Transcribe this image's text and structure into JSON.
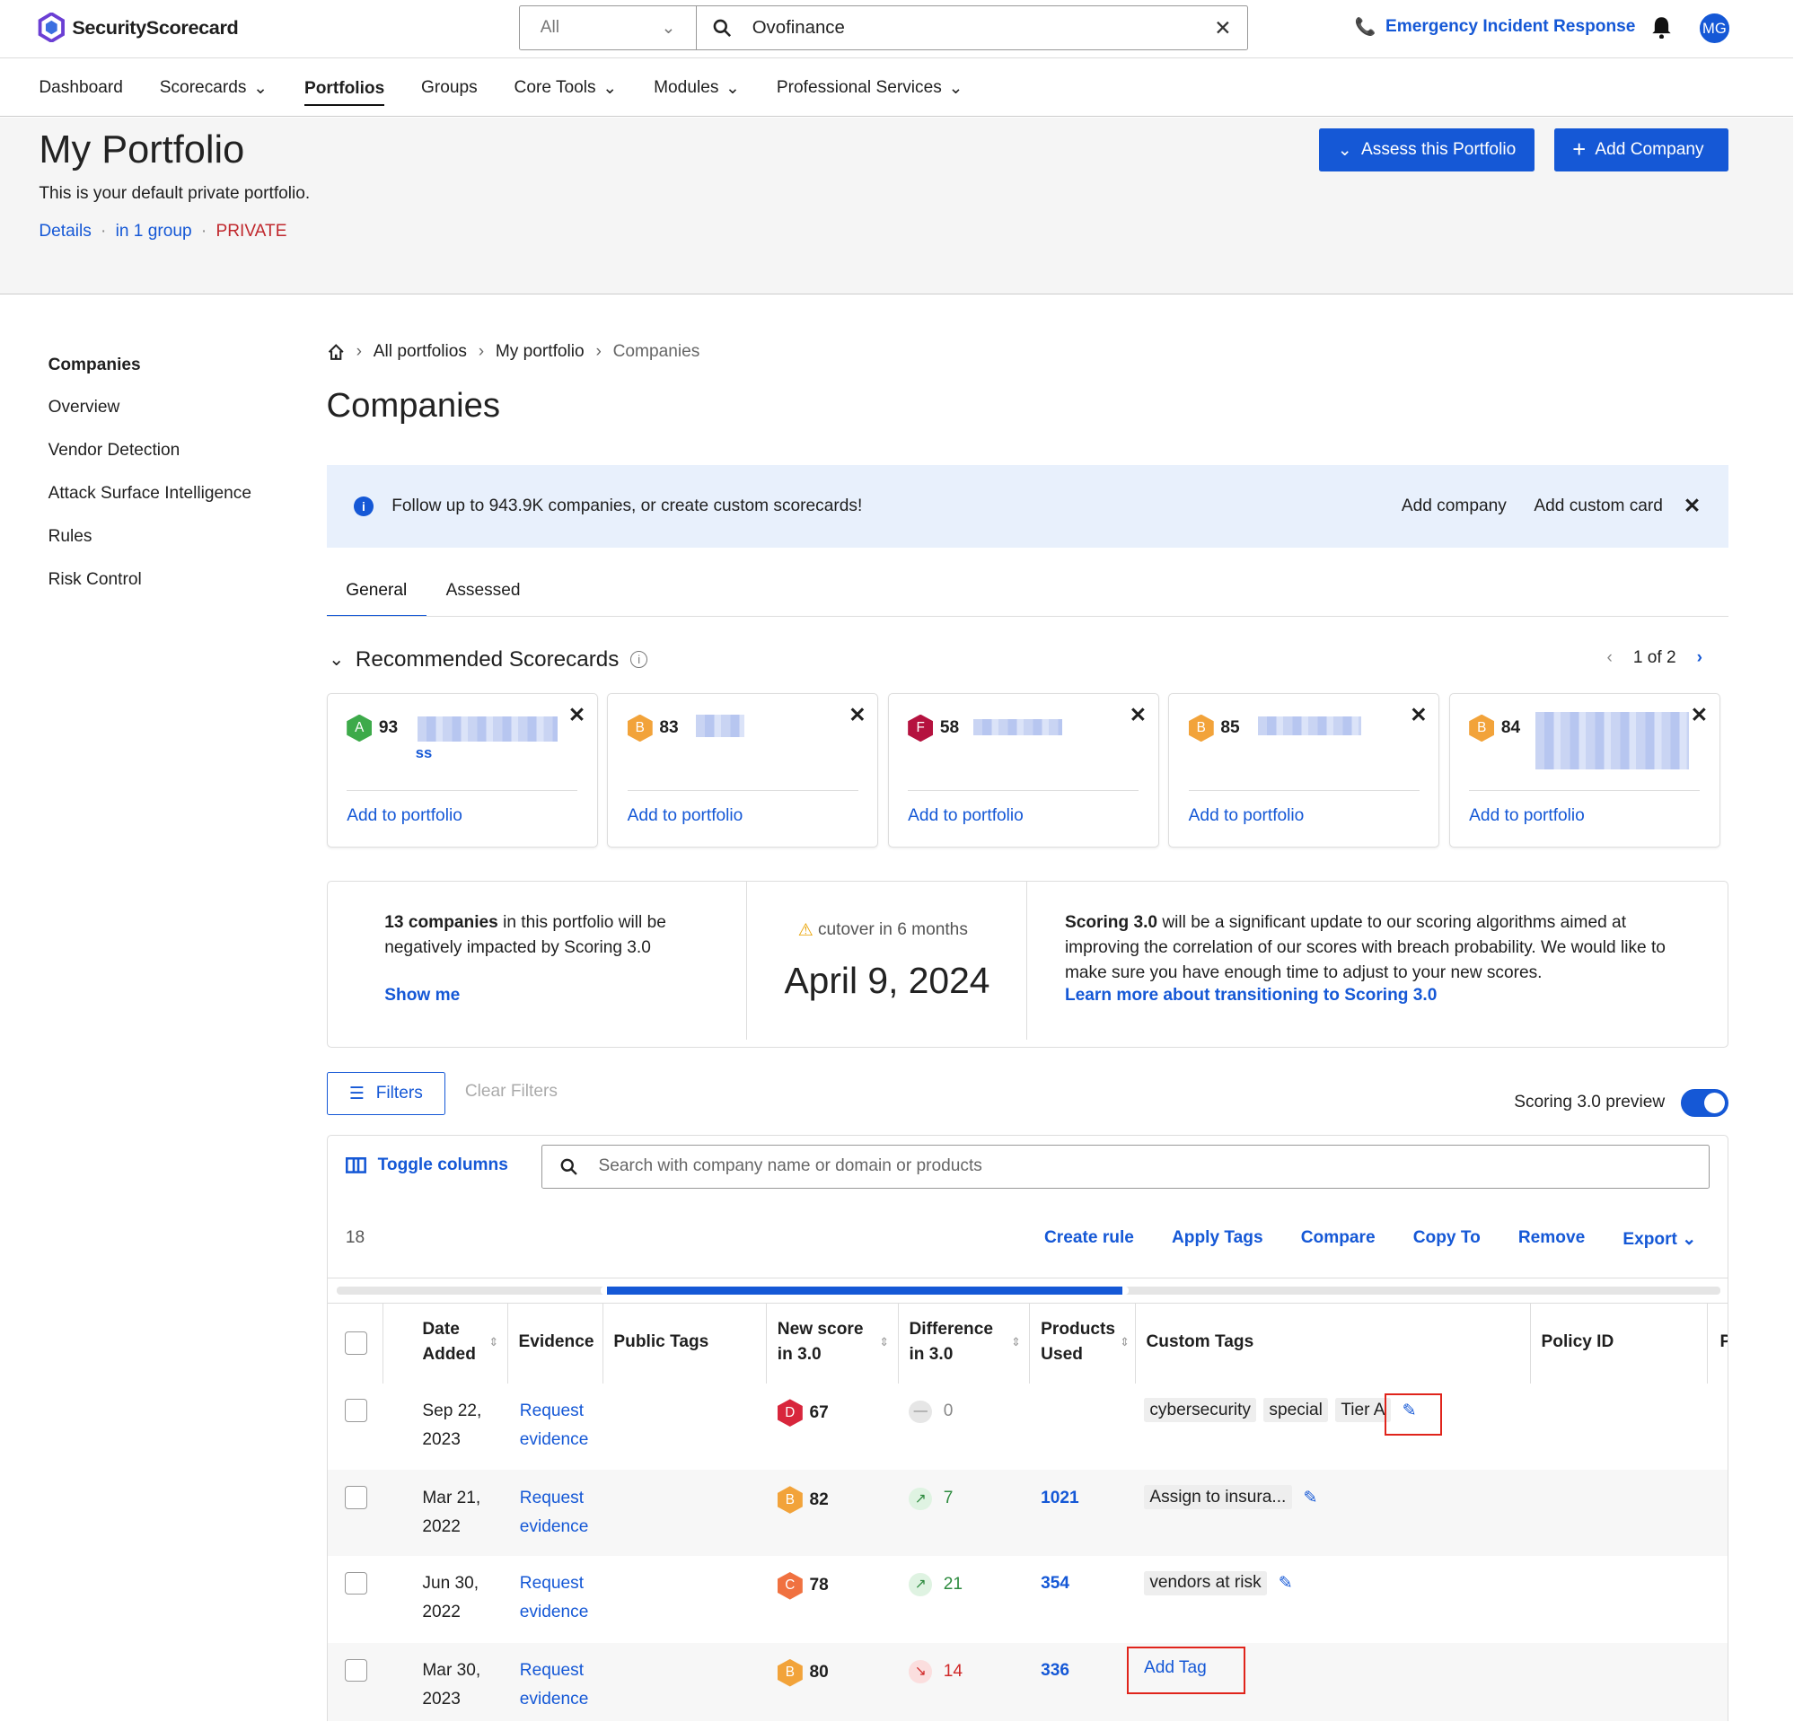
{
  "app": {
    "brand": "SecurityScorecard"
  },
  "search": {
    "scope": "All",
    "query": "Ovofinance"
  },
  "header_actions": {
    "emergency": "Emergency Incident Response",
    "avatar": "MG"
  },
  "nav": [
    "Dashboard",
    "Scorecards",
    "Portfolios",
    "Groups",
    "Core Tools",
    "Modules",
    "Professional Services"
  ],
  "portfolio": {
    "title": "My Portfolio",
    "subtitle": "This is your default private portfolio.",
    "details": "Details",
    "groups": "in 1 group",
    "visibility": "PRIVATE",
    "assess_button": "Assess this Portfolio",
    "add_button": "Add Company"
  },
  "sidebar": [
    "Companies",
    "Overview",
    "Vendor Detection",
    "Attack Surface Intelligence",
    "Rules",
    "Risk Control"
  ],
  "breadcrumb": [
    "All portfolios",
    "My portfolio",
    "Companies"
  ],
  "page_title": "Companies",
  "banner": {
    "text": "Follow up to 943.9K companies, or create custom scorecards!",
    "add_company": "Add company",
    "add_card": "Add custom card"
  },
  "tabs": [
    "General",
    "Assessed"
  ],
  "recommended": {
    "title": "Recommended Scorecards",
    "pager": "1 of 2",
    "add_label": "Add to portfolio",
    "cards": [
      {
        "grade": "A",
        "score": "93",
        "color": "#3daa4a",
        "extra": "ss"
      },
      {
        "grade": "B",
        "score": "83",
        "color": "#f2a33a"
      },
      {
        "grade": "F",
        "score": "58",
        "color": "#b5123f"
      },
      {
        "grade": "B",
        "score": "85",
        "color": "#f2a33a"
      },
      {
        "grade": "B",
        "score": "84",
        "color": "#f2a33a"
      }
    ]
  },
  "scoring": {
    "count": "13 companies",
    "impact": " in this portfolio will be negatively impacted by Scoring 3.0",
    "show_me": "Show me",
    "cutover": "cutover in 6 months",
    "date": "April 9, 2024",
    "title": "Scoring 3.0",
    "desc": " will be a significant update to our scoring algorithms aimed at improving the correlation of our scores with breach probability. We would like to make sure you have enough time to adjust to your new scores.",
    "learn": "Learn more about transitioning to Scoring 3.0"
  },
  "filters": {
    "label": "Filters",
    "clear": "Clear Filters",
    "preview": "Scoring 3.0 preview"
  },
  "table": {
    "toggle": "Toggle columns",
    "search_placeholder": "Search with company name or domain or products",
    "count": "18",
    "actions": [
      "Create rule",
      "Apply Tags",
      "Compare",
      "Copy To",
      "Remove",
      "Export"
    ],
    "headers": {
      "date": "Date Added",
      "evidence": "Evidence",
      "public_tags": "Public Tags",
      "new_score": "New score in 3.0",
      "difference": "Difference in 3.0",
      "products": "Products Used",
      "custom_tags": "Custom Tags",
      "policy": "Policy ID",
      "next": "P"
    },
    "rows": [
      {
        "date": "Sep 22, 2023",
        "evidence": "Request evidence",
        "grade": "D",
        "score": "67",
        "grade_color": "#d8263c",
        "diff": "0",
        "diff_dir": "flat",
        "products": "",
        "tags": [
          "cybersecurity",
          "special",
          "Tier A"
        ],
        "add_tag": ""
      },
      {
        "date": "Mar 21, 2022",
        "evidence": "Request evidence",
        "grade": "B",
        "score": "82",
        "grade_color": "#f2a33a",
        "diff": "7",
        "diff_dir": "up",
        "products": "1021",
        "tags": [
          "Assign to insura..."
        ],
        "add_tag": ""
      },
      {
        "date": "Jun 30, 2022",
        "evidence": "Request evidence",
        "grade": "C",
        "score": "78",
        "grade_color": "#f07140",
        "diff": "21",
        "diff_dir": "up",
        "products": "354",
        "tags": [
          "vendors at risk"
        ],
        "add_tag": ""
      },
      {
        "date": "Mar 30, 2023",
        "evidence": "Request evidence",
        "grade": "B",
        "score": "80",
        "grade_color": "#f2a33a",
        "diff": "14",
        "diff_dir": "down",
        "products": "336",
        "tags": [],
        "add_tag": "Add Tag"
      }
    ]
  }
}
